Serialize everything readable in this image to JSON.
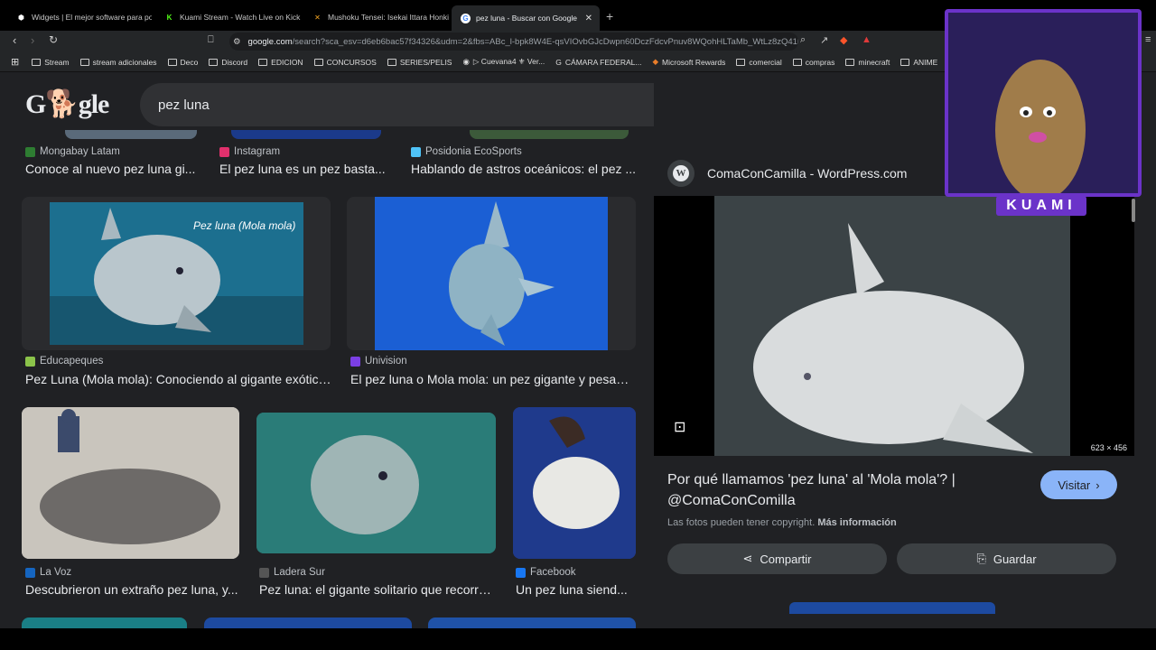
{
  "tabs": [
    {
      "label": "Widgets | El mejor software para pot",
      "color": "#ffffff"
    },
    {
      "label": "Kuami Stream - Watch Live on Kick",
      "color": "#53fc18"
    },
    {
      "label": "Mushoku Tensei: Isekai Ittara Honki D",
      "color": "#f5a623"
    },
    {
      "label": "pez luna - Buscar con Google",
      "color": "#ffffff",
      "active": true
    }
  ],
  "omnibox": {
    "host": "google.com",
    "path": "/search?sca_esv=d6eb6bac57f34326&udm=2&fbs=ABc_l-bpk8W4E-qsVIOvbGJcDwpn60DczFdcvPnuv8WQohHLTaMb_WtLz8zQ41b..."
  },
  "bookmarks": [
    {
      "label": "Stream"
    },
    {
      "label": "stream adicionales"
    },
    {
      "label": "Deco"
    },
    {
      "label": "Discord"
    },
    {
      "label": "EDICION"
    },
    {
      "label": "CONCURSOS"
    },
    {
      "label": "SERIES/PELIS"
    },
    {
      "label": "▷ Cuevana4 ⚜ Ver..."
    },
    {
      "label": "CÁMARA FEDERAL..."
    },
    {
      "label": "Microsoft Rewards"
    },
    {
      "label": "comercial"
    },
    {
      "label": "compras"
    },
    {
      "label": "minecraft"
    },
    {
      "label": "ANIME"
    }
  ],
  "search": {
    "logo": "Google",
    "query": "pez luna"
  },
  "results": [
    {
      "source": "Mongabay Latam",
      "caption": "Conoce al nuevo pez luna gi...",
      "icon_color": "#2e7d32"
    },
    {
      "source": "Instagram",
      "caption": "El pez luna es un pez basta...",
      "icon_color": "#e1306c"
    },
    {
      "source": "Posidonia EcoSports",
      "caption": "Hablando de astros oceánicos: el pez ...",
      "icon_color": "#4fc3f7"
    },
    {
      "source": "Educapeques",
      "caption": "Pez Luna (Mola mola): Conociendo al gigante exótico...",
      "icon_color": "#8bc34a",
      "thumb_text": "Pez luna (Mola mola)"
    },
    {
      "source": "Univision",
      "caption": "El pez luna o Mola mola: un pez gigante y pesad...",
      "icon_color": "#7b3fe4"
    },
    {
      "source": "La Voz",
      "caption": "Descubrieron un extraño pez luna, y...",
      "icon_color": "#1565c0"
    },
    {
      "source": "Ladera Sur",
      "caption": "Pez luna: el gigante solitario que recorre...",
      "icon_color": "#333333"
    },
    {
      "source": "Facebook",
      "caption": "Un pez luna siend...",
      "icon_color": "#1877f2"
    }
  ],
  "panel": {
    "source": "ComaConCamilla - WordPress.com",
    "dimensions": "623 × 456",
    "title": "Por qué llamamos 'pez luna' al 'Mola mola'? | @ComaConComilla",
    "visit_label": "Visitar",
    "copyright": "Las fotos pueden tener copyright.",
    "more_info": "Más información",
    "share_label": "Compartir",
    "save_label": "Guardar"
  },
  "overlay": {
    "name": "KUAMI"
  },
  "colors": {
    "accent": "#8ab4f8",
    "overlay": "#6b33c9",
    "background": "#202124"
  }
}
